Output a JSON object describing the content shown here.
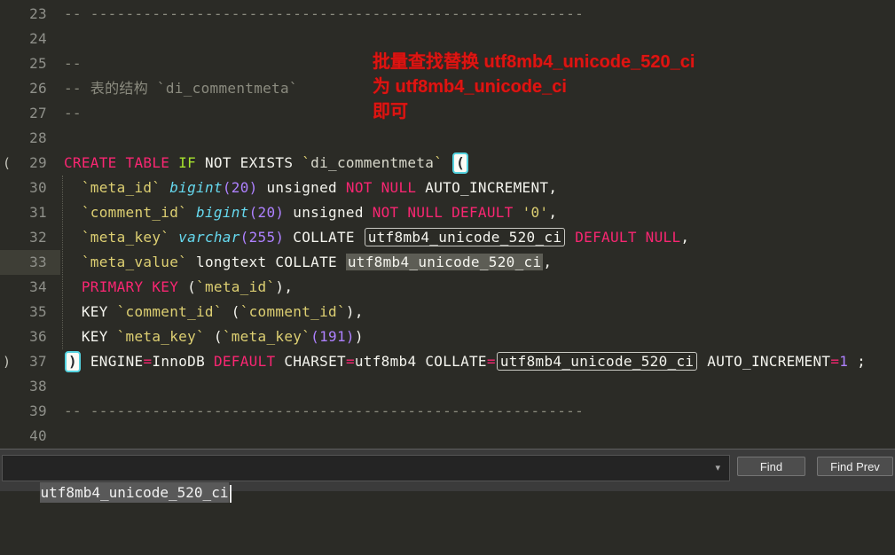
{
  "annotation": {
    "line1": "批量查找替换 utf8mb4_unicode_520_ci",
    "line2": "为 utf8mb4_unicode_ci",
    "line3": "即可",
    "color": "#dc1512"
  },
  "find_bar": {
    "value": "utf8mb4_unicode_520_ci",
    "dropdown_icon": "▾",
    "find_label": "Find",
    "find_prev_label": "Find Prev"
  },
  "colors": {
    "editor_background": "#2b2b26",
    "keyword_pink": "#f92672",
    "keyword_green": "#a6e22e",
    "type_cyan": "#66d9ef",
    "number_purple": "#ae81ff",
    "identifier_yellow": "#ddcf72",
    "comment_gray": "#8b8b7f",
    "plain_text": "#f4f4ee",
    "line_number": "#8f908a",
    "current_line_gutter": "#3e3e36",
    "match_fill": "#5d5d55",
    "match_outline": "#c9c9c3",
    "bracket_highlight_border": "#55d3e0",
    "annotation_red": "#dc1512",
    "findbar_background": "#3b3b3b"
  },
  "editor": {
    "lines": [
      {
        "num": "23",
        "margin": "",
        "tokens": [
          [
            "cm",
            "-- --------------------------------------------------------"
          ]
        ]
      },
      {
        "num": "24",
        "margin": "",
        "tokens": []
      },
      {
        "num": "25",
        "margin": "",
        "tokens": [
          [
            "cm",
            "--"
          ]
        ]
      },
      {
        "num": "26",
        "margin": "",
        "tokens": [
          [
            "cm",
            "-- 表的结构 `di_commentmeta`"
          ]
        ]
      },
      {
        "num": "27",
        "margin": "",
        "tokens": [
          [
            "cm",
            "--"
          ]
        ]
      },
      {
        "num": "28",
        "margin": "",
        "tokens": []
      },
      {
        "num": "29",
        "margin": "(",
        "tokens": [
          [
            "pk",
            "CREATE TABLE"
          ],
          [
            "wh",
            " "
          ],
          [
            "gn",
            "IF"
          ],
          [
            "wh",
            " NOT EXISTS "
          ],
          [
            "yl",
            "`"
          ],
          [
            "wi",
            "di_commentmeta"
          ],
          [
            "yl",
            "`"
          ],
          [
            "wh",
            " "
          ],
          [
            "bh",
            "("
          ]
        ]
      },
      {
        "num": "30",
        "margin": "",
        "tokens": [
          [
            "wh",
            "  "
          ],
          [
            "yl",
            "`meta_id`"
          ],
          [
            "wh",
            " "
          ],
          [
            "cy",
            "bigint"
          ],
          [
            "pu",
            "(20)"
          ],
          [
            "wh",
            " unsigned "
          ],
          [
            "pk",
            "NOT NULL"
          ],
          [
            "wh",
            " AUTO_INCREMENT,"
          ]
        ]
      },
      {
        "num": "31",
        "margin": "",
        "tokens": [
          [
            "wh",
            "  "
          ],
          [
            "yl",
            "`comment_id`"
          ],
          [
            "wh",
            " "
          ],
          [
            "cy",
            "bigint"
          ],
          [
            "pu",
            "(20)"
          ],
          [
            "wh",
            " unsigned "
          ],
          [
            "pk",
            "NOT NULL DEFAULT"
          ],
          [
            "wh",
            " "
          ],
          [
            "yl",
            "'0'"
          ],
          [
            "wh",
            ","
          ]
        ]
      },
      {
        "num": "32",
        "margin": "",
        "tokens": [
          [
            "wh",
            "  "
          ],
          [
            "yl",
            "`meta_key`"
          ],
          [
            "wh",
            " "
          ],
          [
            "cy",
            "varchar"
          ],
          [
            "pu",
            "(255)"
          ],
          [
            "wh",
            " COLLATE "
          ],
          [
            "box",
            "utf8mb4_unicode_520_ci"
          ],
          [
            "wh",
            " "
          ],
          [
            "pk",
            "DEFAULT NULL"
          ],
          [
            "wh",
            ","
          ]
        ]
      },
      {
        "num": "33",
        "margin": "",
        "current": true,
        "tokens": [
          [
            "wh",
            "  "
          ],
          [
            "yl",
            "`meta_value`"
          ],
          [
            "wh",
            " longtext COLLATE "
          ],
          [
            "fill",
            "utf8mb4_unicode_520_ci"
          ],
          [
            "wh",
            ","
          ]
        ]
      },
      {
        "num": "34",
        "margin": "",
        "tokens": [
          [
            "wh",
            "  "
          ],
          [
            "pk",
            "PRIMARY KEY"
          ],
          [
            "wh",
            " ("
          ],
          [
            "yl",
            "`meta_id`"
          ],
          [
            "wh",
            "),"
          ]
        ]
      },
      {
        "num": "35",
        "margin": "",
        "tokens": [
          [
            "wh",
            "  KEY "
          ],
          [
            "yl",
            "`comment_id`"
          ],
          [
            "wh",
            " ("
          ],
          [
            "yl",
            "`comment_id`"
          ],
          [
            "wh",
            "),"
          ]
        ]
      },
      {
        "num": "36",
        "margin": "",
        "tokens": [
          [
            "wh",
            "  KEY "
          ],
          [
            "yl",
            "`meta_key`"
          ],
          [
            "wh",
            " ("
          ],
          [
            "yl",
            "`meta_key`"
          ],
          [
            "pu",
            "(191)"
          ],
          [
            "wh",
            ")"
          ]
        ]
      },
      {
        "num": "37",
        "margin": ")",
        "tokens": [
          [
            "bh",
            ")"
          ],
          [
            "wh",
            " ENGINE"
          ],
          [
            "pk",
            "="
          ],
          [
            "wh",
            "InnoDB "
          ],
          [
            "pk",
            "DEFAULT"
          ],
          [
            "wh",
            " CHARSET"
          ],
          [
            "pk",
            "="
          ],
          [
            "wh",
            "utf8mb4 COLLATE"
          ],
          [
            "pk",
            "="
          ],
          [
            "box",
            "utf8mb4_unicode_520_ci"
          ],
          [
            "wh",
            " AUTO_INCREMENT"
          ],
          [
            "pk",
            "="
          ],
          [
            "pu",
            "1"
          ],
          [
            "wh",
            " ;"
          ]
        ]
      },
      {
        "num": "38",
        "margin": "",
        "tokens": []
      },
      {
        "num": "39",
        "margin": "",
        "tokens": [
          [
            "cm",
            "-- --------------------------------------------------------"
          ]
        ]
      },
      {
        "num": "40",
        "margin": "",
        "tokens": []
      }
    ]
  }
}
